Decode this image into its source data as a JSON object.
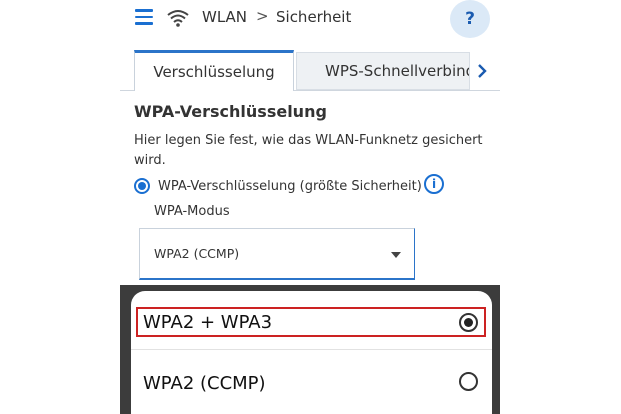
{
  "header": {
    "breadcrumb_1": "WLAN",
    "separator": ">",
    "breadcrumb_2": "Sicherheit",
    "help_label": "?"
  },
  "tabs": [
    {
      "label": "Verschlüsselung",
      "active": true
    },
    {
      "label": "WPS-Schnellverbindung",
      "active": false
    }
  ],
  "content": {
    "title": "WPA-Verschlüsselung",
    "description": "Hier legen Sie fest, wie das WLAN-Funknetz gesichert wird.",
    "radio_label": "WPA-Verschlüsselung (größte Sicherheit)",
    "info_label": "i",
    "mode_label": "WPA-Modus",
    "select_value": "WPA2 (CCMP)"
  },
  "dropdown": {
    "options": [
      {
        "label": "WPA2 + WPA3",
        "selected": true
      },
      {
        "label": "WPA2 (CCMP)",
        "selected": false
      }
    ]
  },
  "colors": {
    "accent": "#1a6fd1",
    "highlight": "#cc2222",
    "overlay": "#3c3c3c"
  },
  "icons": [
    "menu-icon",
    "wifi-icon",
    "chevron-right-icon",
    "help-icon",
    "info-icon",
    "dropdown-arrow-icon"
  ]
}
